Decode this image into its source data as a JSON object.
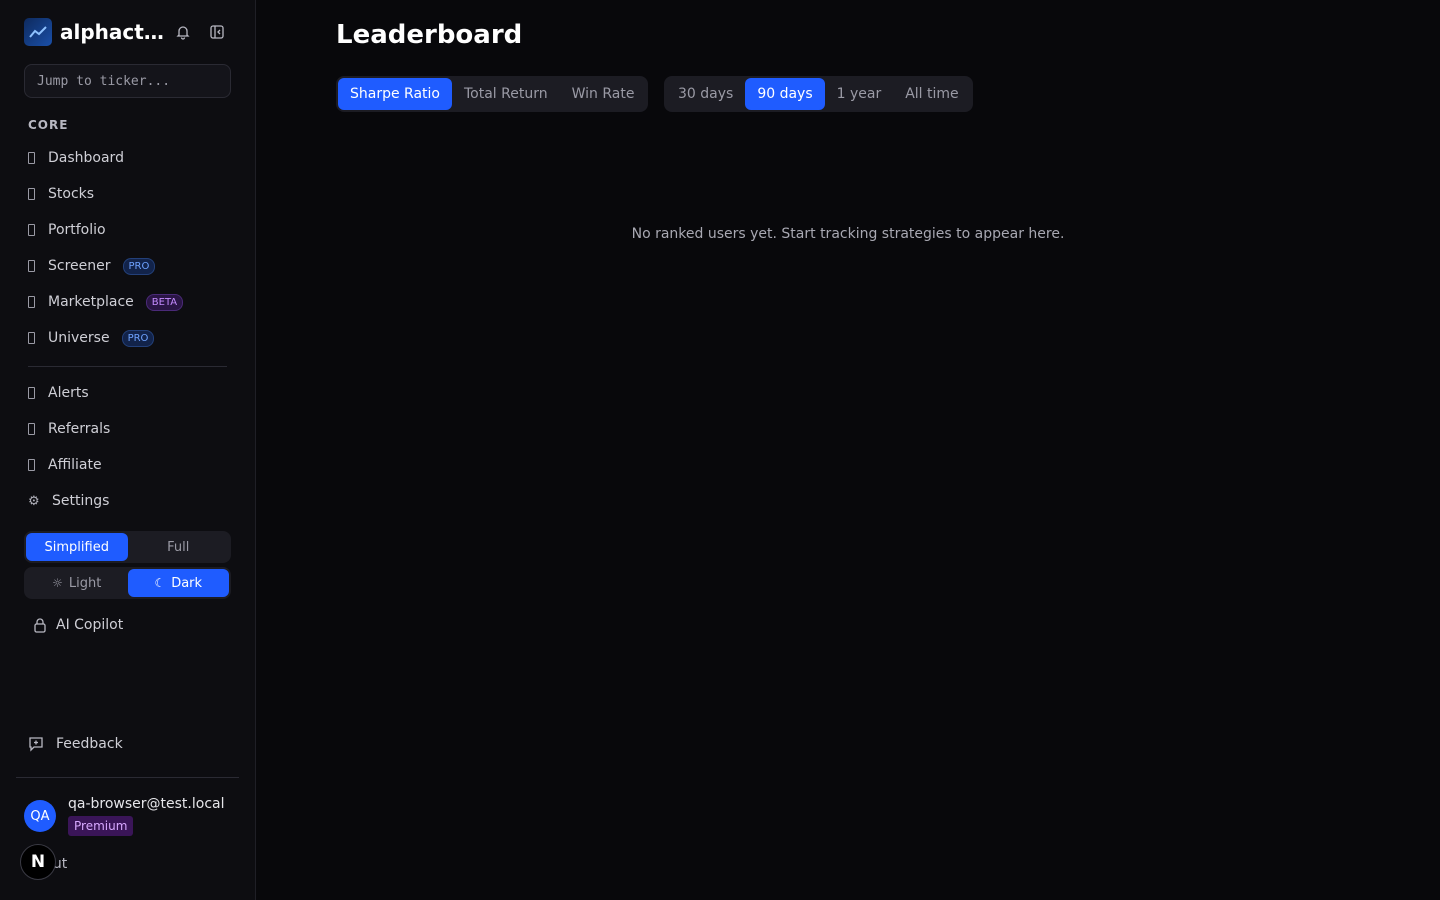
{
  "app": {
    "name": "alphact...",
    "logo_icon": "chart-logo-icon"
  },
  "sidebar": {
    "search_placeholder": "Jump to ticker...",
    "section_label": "CORE",
    "core_items": [
      {
        "label": "Dashboard",
        "badge": ""
      },
      {
        "label": "Stocks",
        "badge": ""
      },
      {
        "label": "Portfolio",
        "badge": ""
      },
      {
        "label": "Screener",
        "badge": "PRO"
      },
      {
        "label": "Marketplace",
        "badge": "BETA"
      },
      {
        "label": "Universe",
        "badge": "PRO"
      }
    ],
    "secondary_items": [
      {
        "label": "Alerts"
      },
      {
        "label": "Referrals"
      },
      {
        "label": "Affiliate"
      },
      {
        "label": "Settings"
      }
    ],
    "mode_toggle": {
      "options": [
        "Simplified",
        "Full"
      ],
      "selected": "Simplified"
    },
    "theme_toggle": {
      "options": [
        "Light",
        "Dark"
      ],
      "selected": "Dark"
    },
    "copilot_label": "AI Copilot",
    "feedback_label": "Feedback",
    "user": {
      "initials": "QA",
      "email": "qa-browser@test.local",
      "plan": "Premium",
      "signout_label": "ı out"
    },
    "next_badge": "N"
  },
  "main": {
    "title": "Leaderboard",
    "metric_tabs": [
      "Sharpe Ratio",
      "Total Return",
      "Win Rate"
    ],
    "metric_selected": "Sharpe Ratio",
    "period_tabs": [
      "30 days",
      "90 days",
      "1 year",
      "All time"
    ],
    "period_selected": "90 days",
    "empty_message": "No ranked users yet. Start tracking strategies to appear here."
  },
  "colors": {
    "accent": "#1f5cff",
    "background": "#08080b",
    "sidebar": "#0d0d11"
  }
}
